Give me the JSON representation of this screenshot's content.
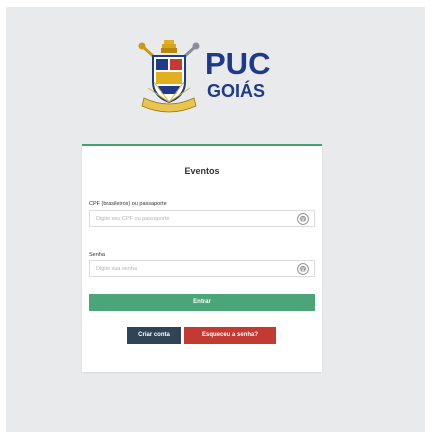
{
  "brand": {
    "name_line1": "PUC",
    "name_line2": "GOIÁS",
    "color": "#1f3a8a",
    "logo_icon": "puc-goias-crest-icon"
  },
  "login": {
    "title": "Eventos",
    "accent_color": "#41a36b",
    "cpf": {
      "label": "CPF (brasileiros) ou passaporte",
      "placeholder": "Digite seu CPF ou passaporte",
      "value": "",
      "icon": "fingerprint-icon"
    },
    "senha": {
      "label": "Senha",
      "placeholder": "Digite sua senha",
      "value": "",
      "icon": "fingerprint-icon"
    },
    "entrar_label": "Entrar",
    "criar_conta_label": "Criar conta",
    "esqueceu_label": "Esqueceu a senha?",
    "colors": {
      "entrar": "#4aa678",
      "criar_conta": "#2f4457",
      "esqueceu": "#c23a31"
    }
  }
}
